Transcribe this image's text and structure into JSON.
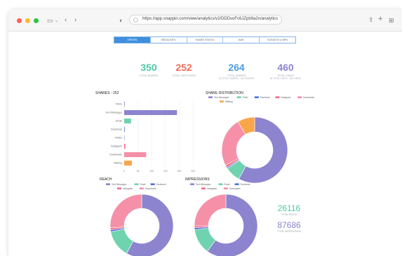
{
  "browser": {
    "url": "https://app.snappin.com/view/analytics/v2/DDDsoFc6JZpb9a2n/analytics",
    "colors": {
      "red": "#fe5f57",
      "yellow": "#febc2e",
      "green": "#28c840"
    }
  },
  "tabs": [
    {
      "label": "SPEEPA",
      "active": true
    },
    {
      "label": "MEDIA INFO",
      "active": false
    },
    {
      "label": "SHARE STATUS",
      "active": false
    },
    {
      "label": "BAR",
      "active": false
    },
    {
      "label": "SCRATCH & BPN",
      "active": false
    }
  ],
  "stats": [
    {
      "value": "350",
      "label": "TOTAL SHARES",
      "sub": "",
      "color": "#4fc9a4"
    },
    {
      "value": "252",
      "label": "TOTAL VISITS DATA",
      "sub": "",
      "color": "#f46b5d"
    },
    {
      "value": "264",
      "label": "TOTAL SHARES",
      "sub": "IN TOTAL SHARES · 264 SHARES",
      "color": "#4d9de0"
    },
    {
      "value": "460",
      "label": "TOTAL VIEWS",
      "sub": "IN TOTAL VISITS · 460 VIEWS",
      "color": "#8c84cf"
    }
  ],
  "impressions_totals": [
    {
      "value": "26116",
      "label": "TOTAL REACH",
      "color": "#4fc9a4"
    },
    {
      "value": "87686",
      "label": "TOTAL IMPRESSIONS",
      "color": "#8c84cf"
    }
  ],
  "chart_data": [
    {
      "type": "bar",
      "orientation": "horizontal",
      "title": "SHARES - 252",
      "categories": [
        "Prints",
        "Text Messages",
        "Email",
        "Facebook",
        "Twitter",
        "Instagram",
        "Downloads",
        "Waiting"
      ],
      "values": [
        0,
        192,
        25,
        2,
        1,
        4,
        80,
        28
      ],
      "colors": [
        "#8c84cf",
        "#8c84cf",
        "#6fd3b0",
        "#4d6fd8",
        "#a9b6f0",
        "#f46b8a",
        "#f590a8",
        "#f9a64a"
      ],
      "xticks": [
        "0",
        "50",
        "100",
        "150",
        "200",
        "250"
      ],
      "xlim": [
        0,
        250
      ]
    },
    {
      "type": "pie",
      "title": "SHARE DISTRIBUTION",
      "legend": [
        "Text Messages",
        "Prints",
        "Facebook",
        "Instagram",
        "Downloads",
        "Waiting"
      ],
      "legend_colors": [
        "#8c84cf",
        "#6fd3b0",
        "#4d6fd8",
        "#f46b8a",
        "#f590a8",
        "#f9a64a"
      ],
      "values": [
        192,
        25,
        2,
        4,
        80,
        28
      ],
      "colors": [
        "#8c84cf",
        "#6fd3b0",
        "#4d6fd8",
        "#f46b8a",
        "#f590a8",
        "#f9a64a"
      ]
    },
    {
      "type": "pie",
      "title": "REACH",
      "legend": [
        "Text Messages",
        "Email",
        "Facebook",
        "Instagram",
        "Downloads"
      ],
      "legend_colors": [
        "#8c84cf",
        "#6fd3b0",
        "#4d6fd8",
        "#f46b8a",
        "#f590a8"
      ],
      "values": [
        58,
        14,
        1,
        1,
        26
      ],
      "colors": [
        "#8c84cf",
        "#6fd3b0",
        "#4d6fd8",
        "#f46b8a",
        "#f590a8"
      ]
    },
    {
      "type": "pie",
      "title": "IMPRESSIONS",
      "legend": [
        "Text Messages",
        "Email",
        "Facebook",
        "Instagram",
        "Downloads"
      ],
      "legend_colors": [
        "#8c84cf",
        "#6fd3b0",
        "#4d6fd8",
        "#f46b8a",
        "#f590a8"
      ],
      "values": [
        60,
        13,
        1,
        1,
        25
      ],
      "colors": [
        "#8c84cf",
        "#6fd3b0",
        "#4d6fd8",
        "#f46b8a",
        "#f590a8"
      ]
    }
  ]
}
